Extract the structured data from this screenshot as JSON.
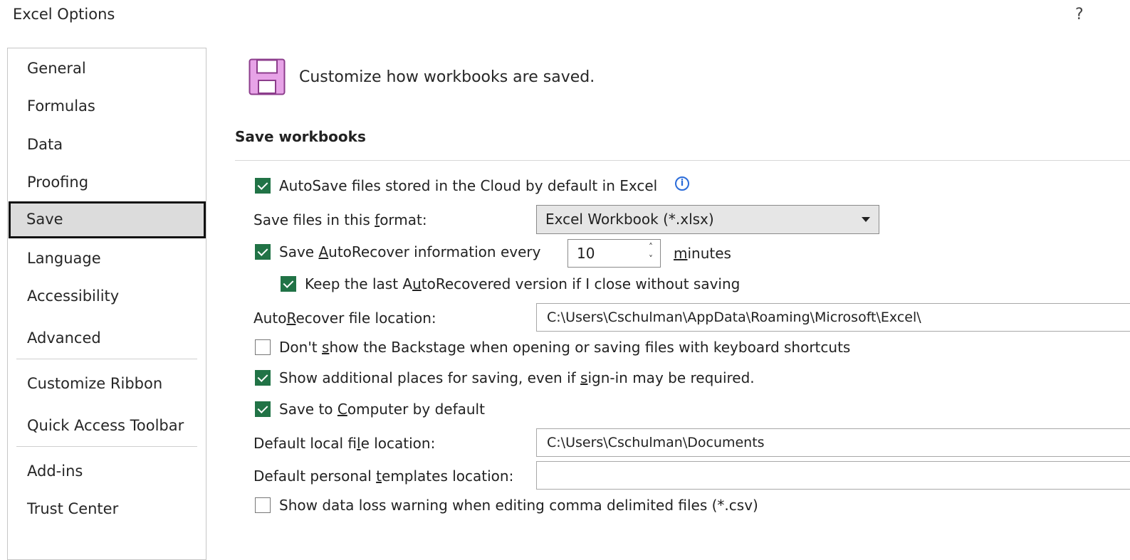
{
  "window": {
    "title": "Excel Options",
    "help": "?"
  },
  "nav": {
    "items": [
      {
        "label": "General"
      },
      {
        "label": "Formulas"
      },
      {
        "label": "Data"
      },
      {
        "label": "Proofing"
      },
      {
        "label": "Save",
        "selected": true
      },
      {
        "label": "Language"
      },
      {
        "label": "Accessibility"
      },
      {
        "label": "Advanced"
      },
      {
        "label": "Customize Ribbon"
      },
      {
        "label": "Quick Access Toolbar"
      },
      {
        "label": "Add-ins"
      },
      {
        "label": "Trust Center"
      }
    ]
  },
  "header": {
    "text": "Customize how workbooks are saved.",
    "icon": "save-icon"
  },
  "section": {
    "title": "Save workbooks"
  },
  "options": {
    "autosave": {
      "label": "AutoSave files stored in the Cloud by default in Excel",
      "checked": true
    },
    "format": {
      "label_pre": "Save files in this ",
      "label_u": "f",
      "label_post": "ormat:",
      "value": "Excel Workbook (*.xlsx)"
    },
    "autorecover": {
      "label_pre": "Save ",
      "label_u": "A",
      "label_post": "utoRecover information every",
      "checked": true,
      "minutes_value": "10",
      "minutes_u": "m",
      "minutes_post": "inutes"
    },
    "keep_last": {
      "label_pre": "Keep the last A",
      "label_u": "u",
      "label_post": "toRecovered version if I close without saving",
      "checked": true
    },
    "autorecover_location": {
      "label_pre": "Auto",
      "label_u": "R",
      "label_post": "ecover file location:",
      "value": "C:\\Users\\Cschulman\\AppData\\Roaming\\Microsoft\\Excel\\"
    },
    "backstage": {
      "label_pre": "Don't ",
      "label_u": "s",
      "label_post": "how the Backstage when opening or saving files with keyboard shortcuts",
      "checked": false
    },
    "additional_places": {
      "label_pre": "Show additional places for saving, even if ",
      "label_u": "s",
      "label_post": "ign-in may be required.",
      "checked": true
    },
    "save_computer": {
      "label_pre": "Save to ",
      "label_u": "C",
      "label_post": "omputer by default",
      "checked": true
    },
    "local_location": {
      "label_pre": "Default local fi",
      "label_u": "l",
      "label_post": "e location:",
      "value": "C:\\Users\\Cschulman\\Documents"
    },
    "templates_location": {
      "label_pre": "Default personal ",
      "label_u": "t",
      "label_post": "emplates location:",
      "value": ""
    },
    "csv_warning": {
      "label": "Show data loss warning when editing comma delimited files (*.csv)",
      "checked": false
    }
  },
  "colors": {
    "checkbox_checked": "#217346",
    "icon_accent": "#d98fd9",
    "selected_nav": "#dcdcdc"
  }
}
